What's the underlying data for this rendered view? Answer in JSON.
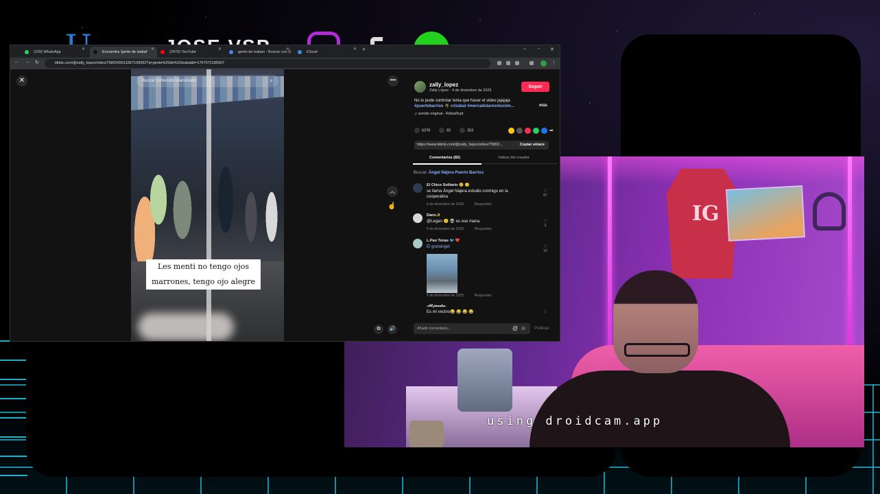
{
  "browser": {
    "tabs": [
      {
        "label": "(109) WhatsApp",
        "favicon_color": "#25d366"
      },
      {
        "label": "Encuentra 'gente de izabal'",
        "favicon_color": "#111111"
      },
      {
        "label": "(2479) YouTube",
        "favicon_color": "#ff0000"
      },
      {
        "label": "gente de izaban - Buscar con G",
        "favicon_color": "#4285f4"
      },
      {
        "label": "iCloud",
        "favicon_color": "#3a8ee6"
      }
    ],
    "new_tab": "+",
    "url": "tiktok.com/@zally_lopez/video/7580249013367193092?q=gente%20de%20izabal&t=1767572185507"
  },
  "tiktok": {
    "search_related_placeholder": "Buscar contenido relacionado",
    "video_caption": "Les menti no tengo ojos marrones, tengo ojo alegre",
    "author": {
      "username": "zally_lopez",
      "display_line": "Zally López · 4 de diciembre de 2025",
      "follow_label": "Seguir"
    },
    "description": "No lo pude controlar tenia que hacer el video jajajaja",
    "hashtags": "#puertobarrios 🌴 crizabal #mercadolarevolución...",
    "more_label": "más",
    "sound": "♫ sonido original - RolasRcpt",
    "stats": {
      "likes": "6378",
      "comments": "82",
      "saves": "353"
    },
    "share_colors": [
      "#f5c518",
      "#555555",
      "#fe2c55",
      "#25d366",
      "#1877f2"
    ],
    "link": "https://www.tiktok.com/@zally_lopez/video/75802...",
    "copy_link_label": "Copiar enlace",
    "tabs": {
      "comments": "Comentarios (82)",
      "creator_videos": "Videos del creador"
    },
    "search_suggestion": {
      "prefix": "Buscar:",
      "query": "Ángel Nájera Puerto Barrios"
    },
    "comments": [
      {
        "name": "El Chico Solitario 😢 🙂",
        "text": "se llama Ángel Nájera estudio conmigo en la cooperativa",
        "date": "6 de diciembre de 2025",
        "reply": "Responder",
        "likes": "67"
      },
      {
        "name": "Dann✨",
        "text": "@Legan 🙂 👽 es ese mana",
        "date": "6 de diciembre de 2025",
        "reply": "Responder",
        "likes": "2"
      },
      {
        "name": "L.Pao Tenas 🐦 ❤️",
        "text": "El granángel",
        "date": "6 de diciembre de 2025",
        "reply": "Responder",
        "likes": "15"
      },
      {
        "name": "𝒜𝓁𝑒𝒿𝒶𝓃𝒹𝓇𝒶.",
        "text": "Es mi vecino😂 😂 😂 😂",
        "date": "",
        "reply": "",
        "likes": ""
      }
    ],
    "comment_placeholder": "Añadir comentario...",
    "publish_label": "Publicar"
  },
  "overlay": {
    "logo_text": "U",
    "brand_text": "JOSE.VSP",
    "webcam_watermark": "using droidcam.app",
    "shirt_logo": "IG"
  }
}
